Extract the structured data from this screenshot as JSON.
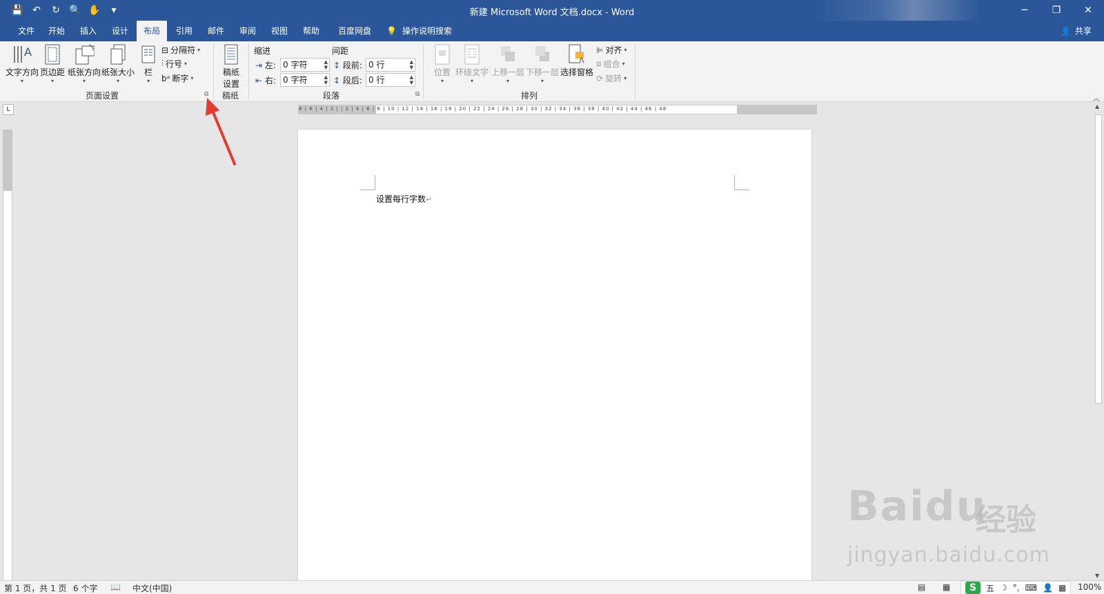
{
  "window": {
    "title": "新建 Microsoft Word 文档.docx  -  Word",
    "controls": {
      "minimize": "─",
      "restore": "❐",
      "close": "✕"
    }
  },
  "qat": {
    "save_icon": "💾",
    "undo_icon": "↶",
    "redo_icon": "↻",
    "preview_icon": "🔍",
    "touch_icon": "✋",
    "customize_icon": "▾"
  },
  "tabs": [
    "文件",
    "开始",
    "插入",
    "设计",
    "布局",
    "引用",
    "邮件",
    "审阅",
    "视图",
    "帮助",
    "百度网盘"
  ],
  "active_tab": "布局",
  "tell_me": {
    "icon": "💡",
    "label": "操作说明搜索"
  },
  "share": {
    "icon": "👤",
    "label": "共享"
  },
  "ribbon": {
    "page_setup": {
      "label": "页面设置",
      "text_direction": "文字方向",
      "margins": "页边距",
      "orientation": "纸张方向",
      "size": "纸张大小",
      "columns": "栏",
      "breaks": "分隔符",
      "line_numbers": "行号",
      "hyphenation": "断字"
    },
    "draft": {
      "label": "稿纸",
      "setting_line1": "稿纸",
      "setting_line2": "设置"
    },
    "paragraph": {
      "label": "段落",
      "indent_heading": "缩进",
      "spacing_heading": "间距",
      "left_label": "左:",
      "right_label": "右:",
      "before_label": "段前:",
      "after_label": "段后:",
      "left_value": "0 字符",
      "right_value": "0 字符",
      "before_value": "0 行",
      "after_value": "0 行"
    },
    "arrange": {
      "label": "排列",
      "position": "位置",
      "wrap_text": "环绕文字",
      "bring_forward": "上移一层",
      "send_backward": "下移一层",
      "selection_pane": "选择窗格",
      "align": "对齐",
      "group": "组合",
      "rotate": "旋转"
    }
  },
  "document": {
    "text": "设置每行字数",
    "para_mark": "↵"
  },
  "ruler": {
    "horizontal_ticks": "8 | 6 | 4 | 2 | | 2 | 4 | 6 | 8 | 10 | 12 | 14 | 16 | 18 | 20 | 22 | 24 | 26 | 28 | 30 | 32 | 34 | 36 | 38 | 40 | 42 | 44 | 46 | 48",
    "tab_selector": "L"
  },
  "status": {
    "page": "第 1 页，共 1 页",
    "words": "6 个字",
    "proof_icon": "📖",
    "language": "中文(中国)",
    "read_mode_icon": "▤",
    "print_layout_icon": "▦",
    "zoom": "100%"
  },
  "ime": {
    "logo": "S",
    "mode": "五",
    "moon": "☽",
    "punct": "°,",
    "keyboard": "⌨",
    "user": "👤",
    "apps": "▦"
  },
  "watermark": {
    "logo_text": "Baidu",
    "cn_text": "经验",
    "url": "jingyan.baidu.com"
  },
  "colors": {
    "accent": "#2b579a",
    "annotation": "#e8392f"
  }
}
